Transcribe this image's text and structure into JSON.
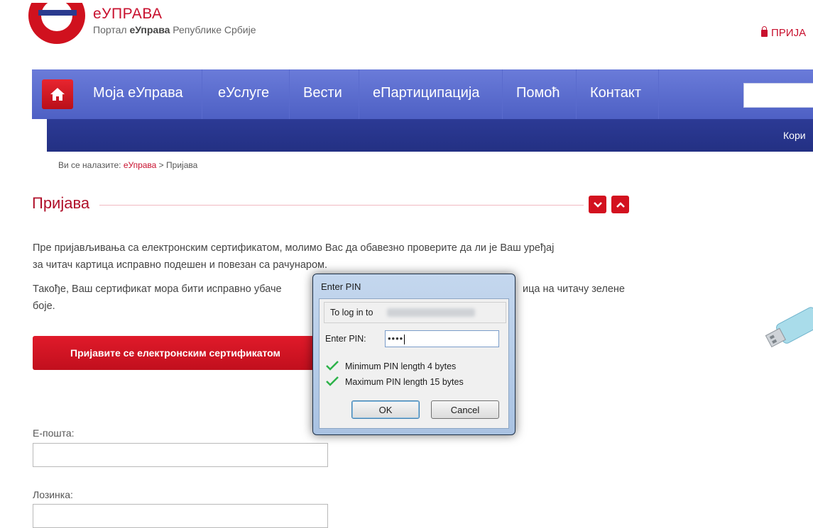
{
  "header": {
    "brand_title": "еУПРАВА",
    "brand_sub_prefix": "Портал ",
    "brand_sub_bold": "еУправа",
    "brand_sub_suffix": " Републике Србије",
    "login_label": "ПРИЈА"
  },
  "nav": {
    "items": [
      "Моја еУправа",
      "еУслуге",
      "Вести",
      "еПартиципација",
      "Помоћ",
      "Контакт"
    ],
    "subnav_text": "Кори"
  },
  "breadcrumb": {
    "prefix": "Ви се налазите: ",
    "link": "еУправа",
    "separator": " > ",
    "current": "Пријава"
  },
  "section": {
    "title": "Пријава"
  },
  "body": {
    "para1_line1": "Пре пријављивања са електронским сертификатом, молимо Вас да обавезно проверите да ли је Ваш уређај",
    "para1_line2": "за читач картица исправно подешен и повезан са рачунаром.",
    "para2_line1_left": "Такође, Ваш сертификат мора бити исправно убаче",
    "para2_line1_right": "ица на читачу зелене",
    "para2_line2": "боје.",
    "cert_button": "Пријавите се електронским сертификатом"
  },
  "form": {
    "email_label": "Е-пошта:",
    "password_label": "Лозинка:"
  },
  "dialog": {
    "title": "Enter PIN",
    "login_to": "To log in to",
    "pin_label": "Enter PIN:",
    "pin_value": "••••",
    "check1": "Minimum PIN length 4 bytes",
    "check2": "Maximum PIN length 15 bytes",
    "ok": "OK",
    "cancel": "Cancel"
  },
  "colors": {
    "accent_red": "#c8102e",
    "nav_blue": "#5b6dcf",
    "subnav_blue": "#27348b",
    "check_green": "#2db34a"
  }
}
